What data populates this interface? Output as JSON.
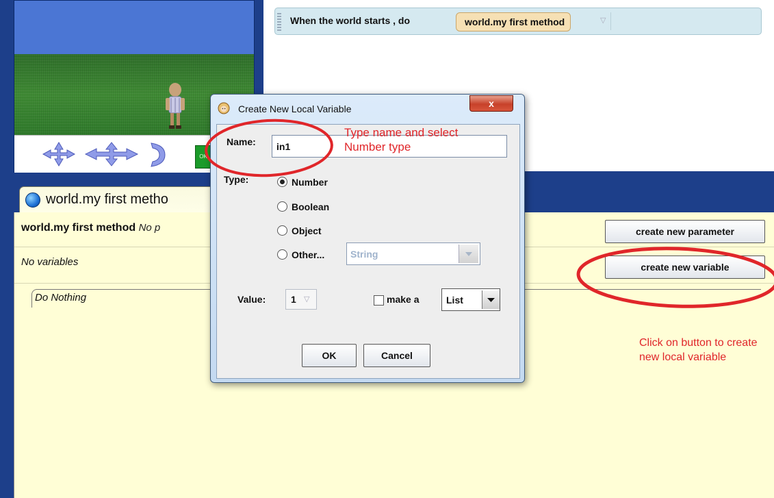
{
  "event_editor": {
    "event_text": "When the world starts , do",
    "method_chip": "world.my first method"
  },
  "world_view": {
    "go_button_label": "OK"
  },
  "method_tab": {
    "label": "world.my first metho"
  },
  "method_editor": {
    "method_name": "world.my first method",
    "params_text": "No p",
    "no_variables": "No variables",
    "do_nothing": "Do Nothing",
    "create_parameter_label": "create new parameter",
    "create_variable_label": "create new variable"
  },
  "dialog": {
    "title": "Create New Local Variable",
    "close_label": "x",
    "name_label": "Name:",
    "name_value": "in1",
    "type_label": "Type:",
    "type_options": [
      "Number",
      "Boolean",
      "Object",
      "Other..."
    ],
    "selected_type": "Number",
    "other_select_value": "String",
    "value_label": "Value:",
    "value_value": "1",
    "make_a_label": "make a",
    "list_select_value": "List",
    "ok_label": "OK",
    "cancel_label": "Cancel"
  },
  "annotations": {
    "top_note": "Type name and select Number type",
    "bottom_note": "Click on button to create new local variable"
  },
  "colors": {
    "background": "#1d3f8a",
    "method_pane": "#fffed6",
    "annotation_red": "#e0262a"
  }
}
